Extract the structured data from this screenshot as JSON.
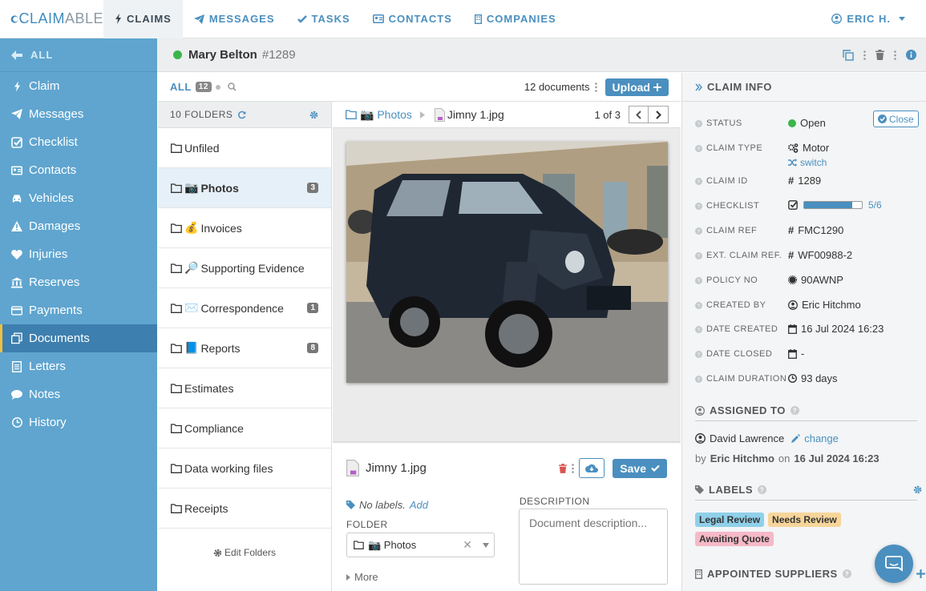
{
  "brand": {
    "logo_prefix": "CLAIM",
    "logo_suffix": "ABLE"
  },
  "topnav": {
    "items": [
      {
        "label": "CLAIMS",
        "icon": "bolt-icon",
        "active": true
      },
      {
        "label": "MESSAGES",
        "icon": "paper-plane-icon"
      },
      {
        "label": "TASKS",
        "icon": "check-icon"
      },
      {
        "label": "CONTACTS",
        "icon": "address-card-icon"
      },
      {
        "label": "COMPANIES",
        "icon": "building-icon"
      }
    ],
    "user": "ERIC H."
  },
  "sidebar": {
    "all_label": "ALL",
    "items": [
      {
        "label": "Claim",
        "icon": "bolt-icon"
      },
      {
        "label": "Messages",
        "icon": "paper-plane-icon"
      },
      {
        "label": "Checklist",
        "icon": "check-square-icon"
      },
      {
        "label": "Contacts",
        "icon": "address-card-icon"
      },
      {
        "label": "Vehicles",
        "icon": "car-icon"
      },
      {
        "label": "Damages",
        "icon": "warning-icon"
      },
      {
        "label": "Injuries",
        "icon": "heart-icon"
      },
      {
        "label": "Reserves",
        "icon": "bank-icon"
      },
      {
        "label": "Payments",
        "icon": "credit-card-icon"
      },
      {
        "label": "Documents",
        "icon": "documents-icon",
        "active": true
      },
      {
        "label": "Letters",
        "icon": "file-text-icon"
      },
      {
        "label": "Notes",
        "icon": "comment-icon"
      },
      {
        "label": "History",
        "icon": "clock-icon"
      }
    ]
  },
  "header": {
    "name": "Mary Belton",
    "claim_number": "1289",
    "status_color": "#3cb54a"
  },
  "docs_bar": {
    "all_label": "ALL",
    "all_count": "12",
    "doc_count": "12 documents",
    "upload_label": "Upload"
  },
  "folders": {
    "count_label": "10 FOLDERS",
    "items": [
      {
        "label": "Unfiled",
        "emoji": "",
        "count": ""
      },
      {
        "label": "Photos",
        "emoji": "📷",
        "count": "3",
        "active": true
      },
      {
        "label": "Invoices",
        "emoji": "💰",
        "count": ""
      },
      {
        "label": "Supporting Evidence",
        "emoji": "🔎",
        "count": ""
      },
      {
        "label": "Correspondence",
        "emoji": "✉️",
        "count": "1"
      },
      {
        "label": "Reports",
        "emoji": "📘",
        "count": "8"
      },
      {
        "label": "Estimates",
        "emoji": "",
        "count": ""
      },
      {
        "label": "Compliance",
        "emoji": "",
        "count": ""
      },
      {
        "label": "Data working files",
        "emoji": "",
        "count": ""
      },
      {
        "label": "Receipts",
        "emoji": "",
        "count": ""
      }
    ],
    "edit_label": "Edit Folders"
  },
  "viewer": {
    "breadcrumb_folder": "📷 Photos",
    "file_name": "Jimny 1.jpg",
    "pager": "1 of 3"
  },
  "detail": {
    "file_name": "Jimny 1.jpg",
    "save_label": "Save",
    "no_labels": "No labels.",
    "add_label": "Add",
    "folder_label": "FOLDER",
    "folder_value": "📷 Photos",
    "more_label": "More",
    "description_label": "DESCRIPTION",
    "description_placeholder": "Document description..."
  },
  "claim_info": {
    "title": "CLAIM INFO",
    "rows": [
      {
        "label": "STATUS",
        "value": "Open"
      },
      {
        "label": "CLAIM TYPE",
        "value": "Motor"
      },
      {
        "label": "CLAIM ID",
        "value": "1289"
      },
      {
        "label": "CHECKLIST",
        "value": "5/6",
        "progress": 0.83
      },
      {
        "label": "CLAIM REF",
        "value": "FMC1290"
      },
      {
        "label": "EXT. CLAIM REF.",
        "value": "WF00988-2"
      },
      {
        "label": "POLICY NO",
        "value": "90AWNP"
      },
      {
        "label": "CREATED BY",
        "value": "Eric Hitchmo"
      },
      {
        "label": "DATE CREATED",
        "value": "16 Jul 2024 16:23"
      },
      {
        "label": "DATE CLOSED",
        "value": "-"
      },
      {
        "label": "CLAIM DURATION",
        "value": "93 days"
      }
    ],
    "close_label": "Close",
    "switch_label": "switch"
  },
  "assigned": {
    "title": "ASSIGNED TO",
    "name": "David Lawrence",
    "change_label": "change",
    "by_prefix": "by",
    "by_name": "Eric Hitchmo",
    "on_label": "on",
    "on_date": "16 Jul 2024 16:23"
  },
  "labels": {
    "title": "LABELS",
    "items": [
      {
        "label": "Legal Review",
        "color": "#8fd0ea"
      },
      {
        "label": "Needs Review",
        "color": "#f7d59a"
      },
      {
        "label": "Awaiting Quote",
        "color": "#f6b9c7"
      }
    ]
  },
  "suppliers": {
    "title": "APPOINTED SUPPLIERS"
  },
  "colors": {
    "accent": "#4a8fbf",
    "sidebar": "#5fa5cf",
    "sidebar_active": "#3d7fae",
    "status_open": "#3cb54a"
  }
}
